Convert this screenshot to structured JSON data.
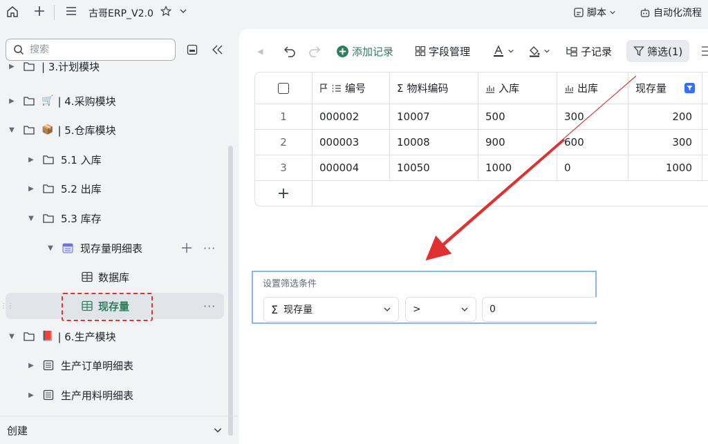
{
  "app": {
    "title": "古哥ERP_V2.0",
    "top_right": {
      "script_label": "脚本",
      "automation_label": "自动化流程"
    }
  },
  "sidebar": {
    "search_placeholder": "搜索",
    "items": [
      {
        "label": "| 3.计划模块",
        "level": 0,
        "expanded": false,
        "emoji": "🗓"
      },
      {
        "label": "| 4.采购模块",
        "level": 0,
        "expanded": false,
        "emoji": "🛒"
      },
      {
        "label": "| 5.仓库模块",
        "level": 0,
        "expanded": true,
        "emoji": "📦"
      },
      {
        "label": "5.1 入库",
        "level": 1,
        "expanded": false
      },
      {
        "label": "5.2 出库",
        "level": 1,
        "expanded": false
      },
      {
        "label": "5.3 库存",
        "level": 1,
        "expanded": true
      },
      {
        "label": "现存量明细表",
        "level": 2,
        "expanded": true
      },
      {
        "label": "数据库",
        "level": 3
      },
      {
        "label": "现存量",
        "level": 3,
        "selected": true
      },
      {
        "label": "| 6.生产模块",
        "level": 0,
        "expanded": true,
        "emoji": "📕"
      },
      {
        "label": "生产订单明细表",
        "level": 1,
        "expanded": false
      },
      {
        "label": "生产用料明细表",
        "level": 1,
        "expanded": false
      }
    ],
    "create_label": "创建"
  },
  "toolbar": {
    "add_record": "添加记录",
    "field_manage": "字段管理",
    "sub_record": "子记录",
    "filter": "筛选(1)"
  },
  "grid": {
    "columns": [
      "编号",
      "物料编码",
      "入库",
      "出库",
      "现存量"
    ],
    "rows": [
      {
        "index": "1",
        "cells": [
          "000002",
          "10007",
          "500",
          "300",
          "200"
        ]
      },
      {
        "index": "2",
        "cells": [
          "000003",
          "10008",
          "900",
          "600",
          "300"
        ]
      },
      {
        "index": "3",
        "cells": [
          "000004",
          "10050",
          "1000",
          "0",
          "1000"
        ]
      }
    ],
    "add_row": "+"
  },
  "filter_panel": {
    "title": "设置筛选条件",
    "field": "现存量",
    "operator": ">",
    "value": "0"
  },
  "colors": {
    "accent_green": "#2e7d5b",
    "annotation_red": "#e03131",
    "filter_border": "#8ab4f8"
  }
}
